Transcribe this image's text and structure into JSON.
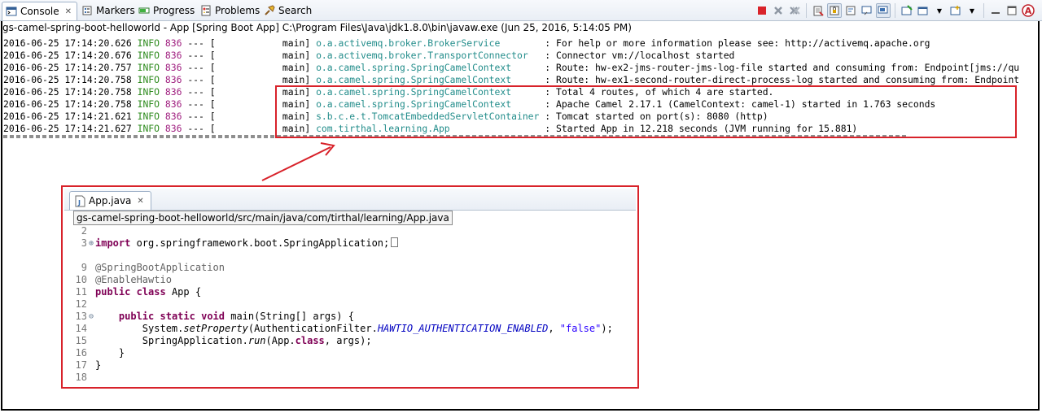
{
  "tabs": [
    {
      "label": "Console",
      "icon": "console-icon",
      "active": true
    },
    {
      "label": "Markers",
      "icon": "markers-icon"
    },
    {
      "label": "Progress",
      "icon": "progress-icon"
    },
    {
      "label": "Problems",
      "icon": "problems-icon"
    },
    {
      "label": "Search",
      "icon": "search-icon"
    }
  ],
  "toolbar": [
    "terminate-icon",
    "remove-launch-icon",
    "remove-all-terminated-icon",
    "clear-console-icon",
    "scroll-lock-icon",
    "word-wrap-icon",
    "show-on-stdout-icon",
    "show-on-stderr-icon",
    "pin-console-icon",
    "display-selected-console-icon",
    "open-console-icon",
    "open-console-dropdown-icon",
    "new-console-view-icon",
    "maximize-icon",
    "minimize-icon",
    "ant-icon"
  ],
  "launch": "gs-camel-spring-boot-helloworld - App [Spring Boot App] C:\\Program Files\\Java\\jdk1.8.0\\bin\\javaw.exe (Jun 25, 2016, 5:14:05 PM)",
  "console_lines": [
    {
      "ts": "2016-06-25 17:14:20.626",
      "lvl": "INFO",
      "pid": "836",
      "sep": "--- [",
      "thread": "           main]",
      "logger": "o.a.activemq.broker.BrokerService",
      "msg": ": For help or more information please see: http://activemq.apache.org"
    },
    {
      "ts": "2016-06-25 17:14:20.676",
      "lvl": "INFO",
      "pid": "836",
      "sep": "--- [",
      "thread": "           main]",
      "logger": "o.a.activemq.broker.TransportConnector",
      "msg": ": Connector vm://localhost started"
    },
    {
      "ts": "2016-06-25 17:14:20.757",
      "lvl": "INFO",
      "pid": "836",
      "sep": "--- [",
      "thread": "           main]",
      "logger": "o.a.camel.spring.SpringCamelContext",
      "msg": ": Route: hw-ex2-jms-router-jms-log-file started and consuming from: Endpoint[jms://qu"
    },
    {
      "ts": "2016-06-25 17:14:20.758",
      "lvl": "INFO",
      "pid": "836",
      "sep": "--- [",
      "thread": "           main]",
      "logger": "o.a.camel.spring.SpringCamelContext",
      "msg": ": Route: hw-ex1-second-router-direct-process-log started and consuming from: Endpoint"
    },
    {
      "ts": "2016-06-25 17:14:20.758",
      "lvl": "INFO",
      "pid": "836",
      "sep": "--- [",
      "thread": "           main]",
      "logger": "o.a.camel.spring.SpringCamelContext",
      "msg": ": Total 4 routes, of which 4 are started."
    },
    {
      "ts": "2016-06-25 17:14:20.758",
      "lvl": "INFO",
      "pid": "836",
      "sep": "--- [",
      "thread": "           main]",
      "logger": "o.a.camel.spring.SpringCamelContext",
      "msg": ": Apache Camel 2.17.1 (CamelContext: camel-1) started in 1.763 seconds"
    },
    {
      "ts": "2016-06-25 17:14:21.621",
      "lvl": "INFO",
      "pid": "836",
      "sep": "--- [",
      "thread": "           main]",
      "logger": "s.b.c.e.t.TomcatEmbeddedServletContainer",
      "msg": ": Tomcat started on port(s): 8080 (http)"
    },
    {
      "ts": "2016-06-25 17:14:21.627",
      "lvl": "INFO",
      "pid": "836",
      "sep": "--- [",
      "thread": "           main]",
      "logger": "com.tirthal.learning.App",
      "msg": ": Started App in 12.218 seconds (JVM running for 15.881)"
    }
  ],
  "editor": {
    "tab_label": "App.java",
    "tooltip": "gs-camel-spring-boot-helloworld/src/main/java/com/tirthal/learning/App.java",
    "lines": [
      {
        "n": "2",
        "fold": "",
        "parts": []
      },
      {
        "n": "3",
        "fold": "⊕",
        "parts": [
          {
            "c": "kw",
            "t": "import"
          },
          {
            "c": "",
            "t": " org.springframework.boot.SpringApplication;"
          }
        ],
        "boxed": true
      },
      {
        "n": "",
        "fold": "",
        "parts": []
      },
      {
        "n": "9",
        "fold": "",
        "parts": [
          {
            "c": "ann",
            "t": "@SpringBootApplication"
          }
        ]
      },
      {
        "n": "10",
        "fold": "",
        "parts": [
          {
            "c": "ann",
            "t": "@EnableHawtio"
          }
        ]
      },
      {
        "n": "11",
        "fold": "",
        "parts": [
          {
            "c": "kw",
            "t": "public"
          },
          {
            "c": "",
            "t": " "
          },
          {
            "c": "kw",
            "t": "class"
          },
          {
            "c": "",
            "t": " App {"
          }
        ]
      },
      {
        "n": "12",
        "fold": "",
        "parts": []
      },
      {
        "n": "13",
        "fold": "⊖",
        "parts": [
          {
            "c": "",
            "t": "    "
          },
          {
            "c": "kw",
            "t": "public"
          },
          {
            "c": "",
            "t": " "
          },
          {
            "c": "kw",
            "t": "static"
          },
          {
            "c": "",
            "t": " "
          },
          {
            "c": "kw",
            "t": "void"
          },
          {
            "c": "",
            "t": " main(String[] args) {"
          }
        ]
      },
      {
        "n": "14",
        "fold": "",
        "parts": [
          {
            "c": "",
            "t": "        System."
          },
          {
            "c": "it",
            "t": "setProperty"
          },
          {
            "c": "",
            "t": "(AuthenticationFilter."
          },
          {
            "c": "stat",
            "t": "HAWTIO_AUTHENTICATION_ENABLED"
          },
          {
            "c": "",
            "t": ", "
          },
          {
            "c": "str",
            "t": "\"false\""
          },
          {
            "c": "",
            "t": ");"
          }
        ]
      },
      {
        "n": "15",
        "fold": "",
        "parts": [
          {
            "c": "",
            "t": "        SpringApplication."
          },
          {
            "c": "it",
            "t": "run"
          },
          {
            "c": "",
            "t": "(App."
          },
          {
            "c": "kw",
            "t": "class"
          },
          {
            "c": "",
            "t": ", args);"
          }
        ]
      },
      {
        "n": "16",
        "fold": "",
        "parts": [
          {
            "c": "",
            "t": "    }"
          }
        ]
      },
      {
        "n": "17",
        "fold": "",
        "parts": [
          {
            "c": "",
            "t": "}"
          }
        ]
      },
      {
        "n": "18",
        "fold": "",
        "parts": []
      }
    ]
  },
  "colors": {
    "highlight_box": "#d8222a",
    "info": "#2e8b1e",
    "pid": "#a02080",
    "logger": "#238d8b"
  }
}
